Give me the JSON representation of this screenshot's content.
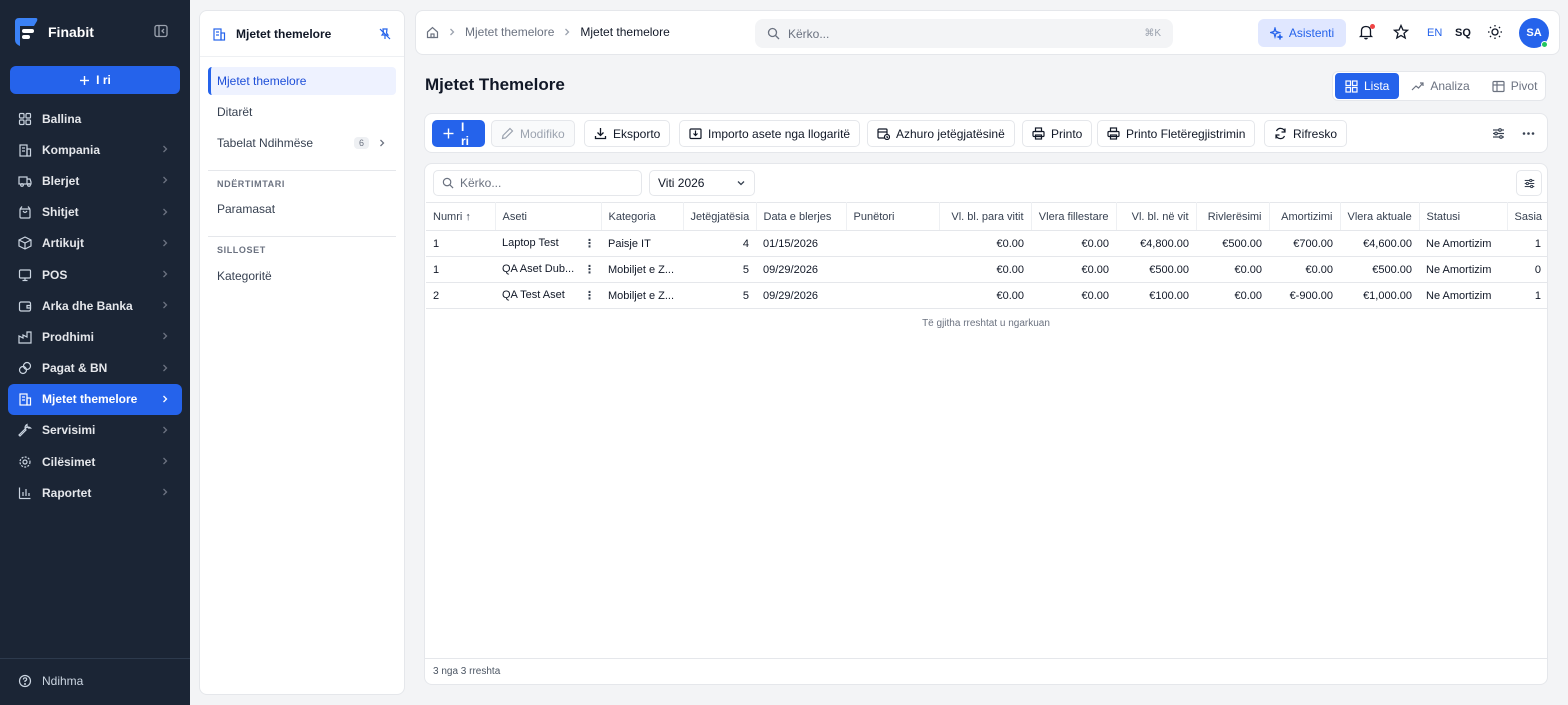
{
  "app": {
    "name": "Finabit",
    "new_label": "I ri",
    "help_label": "Ndihma"
  },
  "nav": [
    {
      "label": "Ballina",
      "icon": "home-icon",
      "chevron": false
    },
    {
      "label": "Kompania",
      "icon": "building-icon",
      "chevron": true
    },
    {
      "label": "Blerjet",
      "icon": "truck-icon",
      "chevron": true
    },
    {
      "label": "Shitjet",
      "icon": "shopping-bag-icon",
      "chevron": true
    },
    {
      "label": "Artikujt",
      "icon": "box-icon",
      "chevron": true
    },
    {
      "label": "POS",
      "icon": "monitor-icon",
      "chevron": true
    },
    {
      "label": "Arka dhe Banka",
      "icon": "wallet-icon",
      "chevron": true
    },
    {
      "label": "Prodhimi",
      "icon": "factory-icon",
      "chevron": true
    },
    {
      "label": "Pagat & BN",
      "icon": "coins-icon",
      "chevron": true
    },
    {
      "label": "Mjetet themelore",
      "icon": "building-icon",
      "chevron": true,
      "active": true
    },
    {
      "label": "Servisimi",
      "icon": "wrench-icon",
      "chevron": true
    },
    {
      "label": "Cilësimet",
      "icon": "gear-icon",
      "chevron": true
    },
    {
      "label": "Raportet",
      "icon": "bar-chart-icon",
      "chevron": true
    }
  ],
  "subpanel": {
    "title": "Mjetet themelore",
    "items": [
      {
        "label": "Mjetet themelore",
        "active": true
      },
      {
        "label": "Ditarët"
      },
      {
        "label": "Tabelat Ndihmëse",
        "badge": "6"
      }
    ],
    "section1": "NDËRTIMTARI",
    "section1_items": [
      "Paramasat"
    ],
    "section2": "SILLOSET",
    "section2_items": [
      "Kategoritë"
    ]
  },
  "topbar": {
    "crumb1": "Mjetet themelore",
    "crumb2": "Mjetet themelore",
    "search_placeholder": "Kërko...",
    "search_shortcut": "⌘K",
    "assistant": "Asistenti",
    "lang_en": "EN",
    "lang_sq": "SQ",
    "avatar": "SA"
  },
  "page": {
    "title": "Mjetet Themelore",
    "views": [
      "Lista",
      "Analiza",
      "Pivot"
    ]
  },
  "toolbar": {
    "new": "I ri",
    "edit": "Modifiko",
    "export": "Eksporto",
    "import": "Importo asete nga llogaritë",
    "update": "Azhuro jetëgjatësinë",
    "print": "Printo",
    "print_sheet": "Printo Fletëregjistrimin",
    "refresh": "Rifresko"
  },
  "table": {
    "search_placeholder": "Kërko...",
    "year": "Viti 2026",
    "columns": [
      "Numri ↑",
      "Aseti",
      "Kategoria",
      "Jetëgjatësia",
      "Data e blerjes",
      "Punëtori",
      "Vl. bl. para vitit",
      "Vlera fillestare",
      "Vl. bl. në vit",
      "Rivlerësimi",
      "Amortizimi",
      "Vlera aktuale",
      "Statusi",
      "Sasia"
    ],
    "rows": [
      [
        "1",
        "Laptop Test",
        "Paisje IT",
        "4",
        "01/15/2026",
        "",
        "€0.00",
        "€0.00",
        "€4,800.00",
        "€500.00",
        "€700.00",
        "€4,600.00",
        "Ne Amortizim",
        "1"
      ],
      [
        "1",
        "QA Aset Dub...",
        "Mobiljet e Z...",
        "5",
        "09/29/2026",
        "",
        "€0.00",
        "€0.00",
        "€500.00",
        "€0.00",
        "€0.00",
        "€500.00",
        "Ne Amortizim",
        "0"
      ],
      [
        "2",
        "QA Test Aset",
        "Mobiljet e Z...",
        "5",
        "09/29/2026",
        "",
        "€0.00",
        "€0.00",
        "€100.00",
        "€0.00",
        "€-900.00",
        "€1,000.00",
        "Ne Amortizim",
        "1"
      ]
    ],
    "loaded_msg": "Të gjitha rreshtat u ngarkuan",
    "footer": "3 nga 3 rreshta"
  }
}
